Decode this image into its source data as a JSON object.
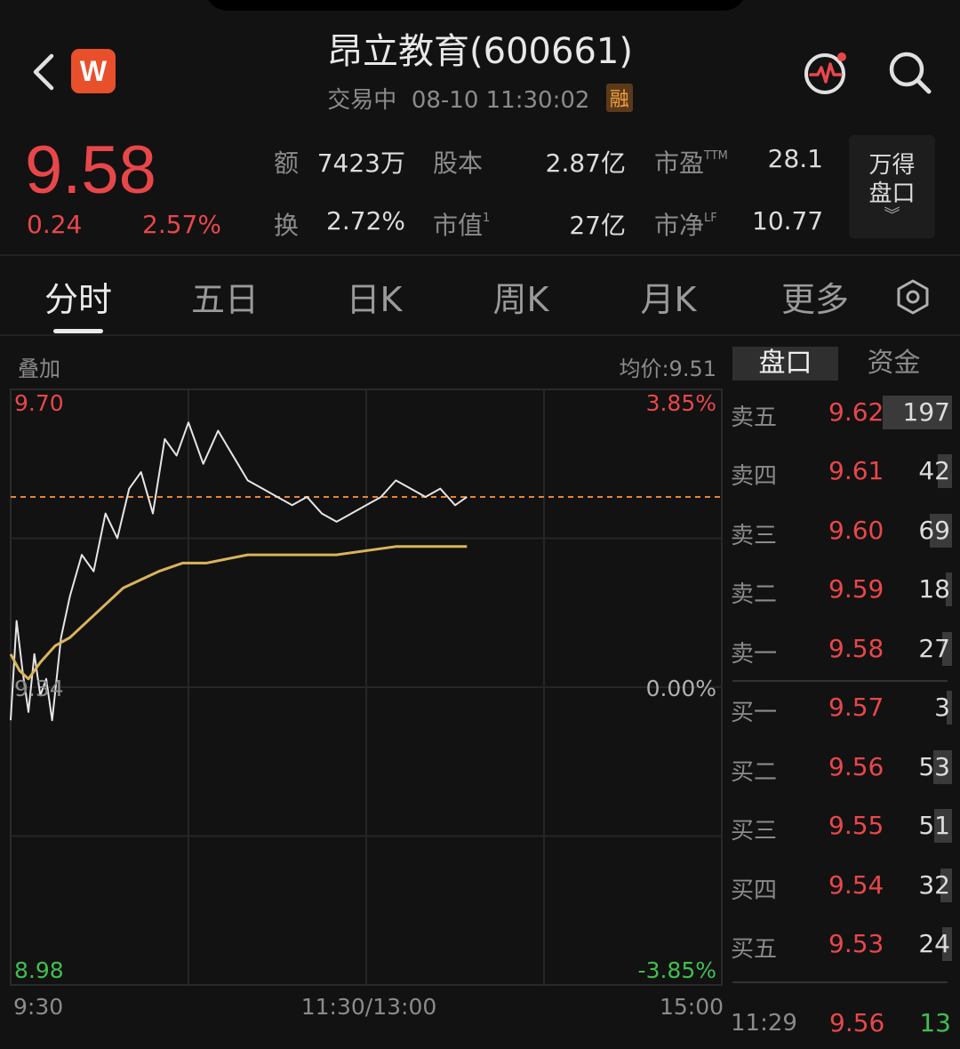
{
  "header": {
    "title": "昂立教育(600661)",
    "status": "交易中",
    "datetime": "08-10 11:30:02",
    "margin_badge": "融",
    "logo_letter": "W"
  },
  "quote": {
    "price": "9.58",
    "change": "0.24",
    "change_pct": "2.57%",
    "stats": {
      "amount_label": "额",
      "amount": "7423万",
      "share_cap_label": "股本",
      "share_cap": "2.87亿",
      "pe_label": "市盈",
      "pe_sup": "TTM",
      "pe": "28.1",
      "turnover_label": "换",
      "turnover": "2.72%",
      "mkt_cap_label": "市值",
      "mkt_cap_sup": "1",
      "mkt_cap": "27亿",
      "pb_label": "市净",
      "pb_sup": "LF",
      "pb": "10.77"
    },
    "wind_button": {
      "line1": "万得",
      "line2": "盘口"
    }
  },
  "tabs": [
    "分时",
    "五日",
    "日K",
    "周K",
    "月K",
    "更多"
  ],
  "active_tab": "分时",
  "chart_header": {
    "overlay": "叠加",
    "avg_price": "均价:9.51"
  },
  "chart_data": {
    "type": "line",
    "y_left_ticks": [
      "9.70",
      "9.34",
      "8.98"
    ],
    "y_right_ticks": [
      "3.85%",
      "0.00%",
      "-3.85%"
    ],
    "x_ticks": [
      "9:30",
      "11:30/13:00",
      "15:00"
    ],
    "ylim": [
      8.98,
      9.7
    ],
    "prev_close": 9.34,
    "colors": {
      "price": "#e6e6e6",
      "avg": "#d9b45a",
      "ref": "#e8862c"
    },
    "series": [
      {
        "values": [
          9.3,
          9.42,
          9.36,
          9.31,
          9.38,
          9.33,
          9.35,
          9.3,
          9.4,
          9.45,
          9.5,
          9.48,
          9.55,
          9.52,
          9.58,
          9.6,
          9.55,
          9.64,
          9.62,
          9.66,
          9.61,
          9.65,
          9.62,
          9.59,
          9.58,
          9.57,
          9.56,
          9.57,
          9.55,
          9.54,
          9.55,
          9.56,
          9.57,
          9.59,
          9.58,
          9.57,
          9.58,
          9.56,
          9.57
        ],
        "x_min": [
          0,
          2,
          4,
          6,
          8,
          10,
          12,
          14,
          17,
          20,
          24,
          28,
          32,
          36,
          40,
          44,
          48,
          52,
          56,
          60,
          65,
          70,
          75,
          80,
          85,
          90,
          95,
          100,
          105,
          110,
          115,
          120,
          125,
          130,
          135,
          140,
          145,
          150,
          154
        ]
      },
      {
        "values": [
          9.38,
          9.36,
          9.35,
          9.37,
          9.39,
          9.4,
          9.42,
          9.44,
          9.46,
          9.47,
          9.48,
          9.49,
          9.49,
          9.5,
          9.5,
          9.5,
          9.51,
          9.51
        ],
        "x_min": [
          0,
          3,
          6,
          10,
          15,
          20,
          26,
          32,
          38,
          44,
          50,
          58,
          66,
          80,
          95,
          110,
          130,
          154
        ]
      }
    ]
  },
  "order_book": {
    "tabs": [
      "盘口",
      "资金"
    ],
    "asks": [
      {
        "label": "卖五",
        "price": "9.62",
        "vol": "197",
        "bar": 0.95
      },
      {
        "label": "卖四",
        "price": "9.61",
        "vol": "42",
        "bar": 0.2
      },
      {
        "label": "卖三",
        "price": "9.60",
        "vol": "69",
        "bar": 0.3
      },
      {
        "label": "卖二",
        "price": "9.59",
        "vol": "18",
        "bar": 0.08
      },
      {
        "label": "卖一",
        "price": "9.58",
        "vol": "27",
        "bar": 0.13
      }
    ],
    "bids": [
      {
        "label": "买一",
        "price": "9.57",
        "vol": "3",
        "bar": 0.02
      },
      {
        "label": "买二",
        "price": "9.56",
        "vol": "53",
        "bar": 0.25
      },
      {
        "label": "买三",
        "price": "9.55",
        "vol": "51",
        "bar": 0.24
      },
      {
        "label": "买四",
        "price": "9.54",
        "vol": "32",
        "bar": 0.16
      },
      {
        "label": "买五",
        "price": "9.53",
        "vol": "24",
        "bar": 0.13
      }
    ],
    "last_tick": {
      "time": "11:29",
      "price": "9.56",
      "vol": "13"
    }
  }
}
